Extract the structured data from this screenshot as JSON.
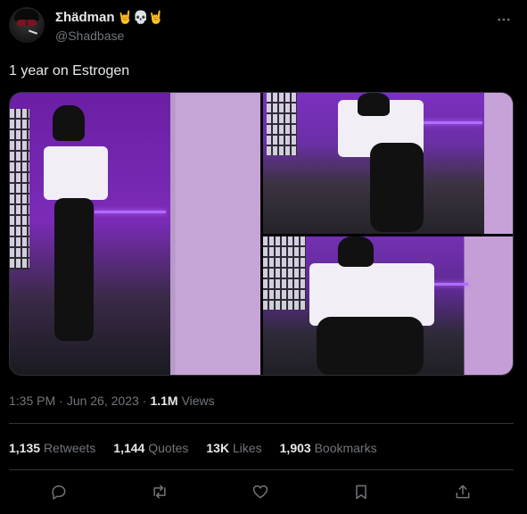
{
  "author": {
    "display_name": "Σhädman",
    "emojis": "🤘💀🤘",
    "handle": "@Shadbase"
  },
  "tweet": {
    "text": "1 year on Estrogen",
    "time": "1:35 PM",
    "separator": "·",
    "date": "Jun 26, 2023",
    "separator2": "·",
    "views_count": "1.1M",
    "views_label": "Views"
  },
  "stats": {
    "retweets": {
      "count": "1,135",
      "label": "Retweets"
    },
    "quotes": {
      "count": "1,144",
      "label": "Quotes"
    },
    "likes": {
      "count": "13K",
      "label": "Likes"
    },
    "bookmarks": {
      "count": "1,903",
      "label": "Bookmarks"
    }
  },
  "icons": {
    "more": "more-horizontal-icon",
    "reply": "reply-icon",
    "retweet": "retweet-icon",
    "like": "heart-icon",
    "bookmark": "bookmark-icon",
    "share": "share-icon"
  },
  "colors": {
    "background": "#000000",
    "primary_text": "#e7e9ea",
    "secondary_text": "#71767b",
    "divider": "#2f3336",
    "neon_accent": "#b46bff"
  }
}
